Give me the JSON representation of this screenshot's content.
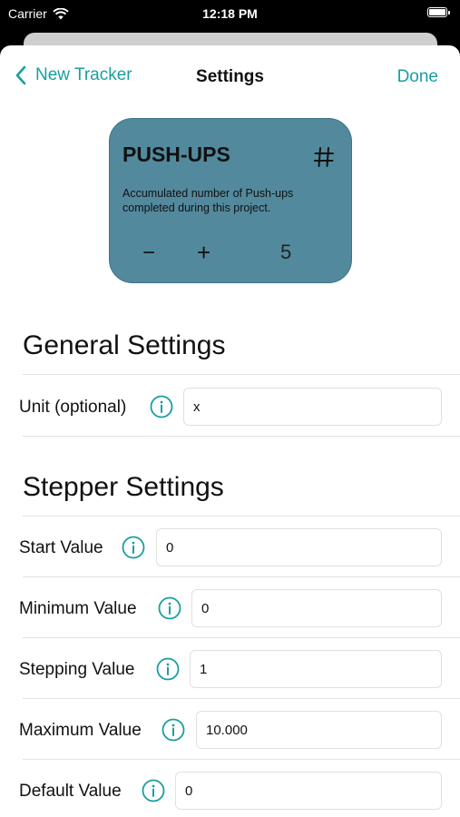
{
  "status_bar": {
    "carrier": "Carrier",
    "time": "12:18 PM"
  },
  "nav": {
    "back_label": "New Tracker",
    "title": "Settings",
    "done_label": "Done"
  },
  "preview_card": {
    "title": "PUSH-UPS",
    "icon": "hash-icon",
    "description": "Accumulated number of Push-ups completed during this project.",
    "decrement": "−",
    "increment": "+",
    "value": "5",
    "color": "#53899d"
  },
  "general": {
    "title": "General Settings",
    "unit": {
      "label": "Unit (optional)",
      "value": "x"
    }
  },
  "stepper": {
    "title": "Stepper Settings",
    "start": {
      "label": "Start Value",
      "value": "0"
    },
    "minimum": {
      "label": "Minimum Value",
      "value": "0"
    },
    "stepping": {
      "label": "Stepping Value",
      "value": "1"
    },
    "maximum": {
      "label": "Maximum Value",
      "value": "10.000"
    },
    "default": {
      "label": "Default Value",
      "value": "0"
    }
  },
  "colors": {
    "accent": "#1a9ea0",
    "card": "#53899d"
  }
}
